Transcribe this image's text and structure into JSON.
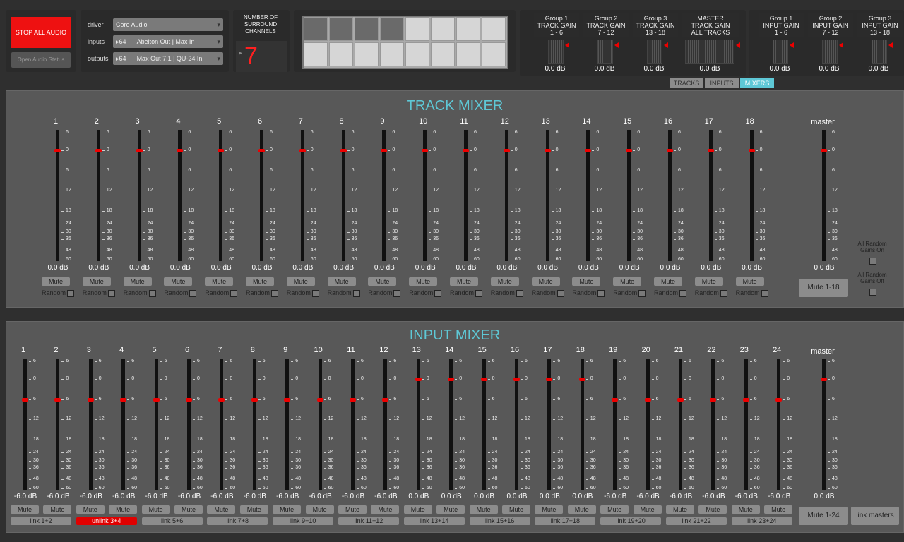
{
  "top": {
    "stop_label": "STOP ALL AUDIO",
    "status_label": "Open Audio Status",
    "driver_label": "driver",
    "driver_value": "Core Audio",
    "inputs_label": "inputs",
    "inputs_count": "64",
    "inputs_value": "Abelton Out | Max In",
    "outputs_label": "outputs",
    "outputs_count": "64",
    "outputs_value": "Max Out 7.1 | QU-24 In",
    "surround_header": "NUMBER OF SURROUND CHANNELS",
    "surround_value": "7",
    "grid_active": [
      true,
      true,
      true,
      true,
      false,
      false,
      false,
      false,
      false,
      false,
      false,
      false,
      false,
      false,
      false,
      false
    ]
  },
  "groups": [
    {
      "lines": [
        "Group 1",
        "TRACK GAIN",
        "1 - 6"
      ],
      "value": "0.0 dB"
    },
    {
      "lines": [
        "Group 2",
        "TRACK GAIN",
        "7 - 12"
      ],
      "value": "0.0 dB"
    },
    {
      "lines": [
        "Group 3",
        "TRACK GAIN",
        "13 - 18"
      ],
      "value": "0.0 dB"
    },
    {
      "lines": [
        "MASTER",
        "TRACK GAIN",
        "ALL TRACKS"
      ],
      "value": "0.0 dB"
    }
  ],
  "input_groups": [
    {
      "lines": [
        "Group 1",
        "INPUT GAIN",
        "1 - 6"
      ],
      "value": "0.0 dB"
    },
    {
      "lines": [
        "Group 2",
        "INPUT GAIN",
        "7 - 12"
      ],
      "value": "0.0 dB"
    },
    {
      "lines": [
        "Group 3",
        "INPUT GAIN",
        "13 - 18"
      ],
      "value": "0.0 dB"
    }
  ],
  "tabs": [
    "TRACKS",
    "INPUTS",
    "MIXERS"
  ],
  "active_tab": "MIXERS",
  "scale_labels": [
    "6",
    "0",
    "6",
    "12",
    "18",
    "24",
    "30",
    "36",
    "48",
    "60"
  ],
  "track_mixer": {
    "title": "TRACK MIXER",
    "channels": [
      "1",
      "2",
      "3",
      "4",
      "5",
      "6",
      "7",
      "8",
      "9",
      "10",
      "11",
      "12",
      "13",
      "14",
      "15",
      "16",
      "17",
      "18"
    ],
    "values_db": [
      "0.0 dB",
      "0.0 dB",
      "0.0 dB",
      "0.0 dB",
      "0.0 dB",
      "0.0 dB",
      "0.0 dB",
      "0.0 dB",
      "0.0 dB",
      "0.0 dB",
      "0.0 dB",
      "0.0 dB",
      "0.0 dB",
      "0.0 dB",
      "0.0 dB",
      "0.0 dB",
      "0.0 dB",
      "0.0 dB"
    ],
    "mute_label": "Mute",
    "random_label": "Random",
    "master_label": "master",
    "master_value": "0.0 dB",
    "mute_all": "Mute 1-18",
    "random_on": "All Random Gains On",
    "random_off": "All Random Gains Off"
  },
  "input_mixer": {
    "title": "INPUT MIXER",
    "channels": [
      "1",
      "2",
      "3",
      "4",
      "5",
      "6",
      "7",
      "8",
      "9",
      "10",
      "11",
      "12",
      "13",
      "14",
      "15",
      "16",
      "17",
      "18",
      "19",
      "20",
      "21",
      "22",
      "23",
      "24"
    ],
    "values_db": [
      "-6.0 dB",
      "-6.0 dB",
      "-6.0 dB",
      "-6.0 dB",
      "-6.0 dB",
      "-6.0 dB",
      "-6.0 dB",
      "-6.0 dB",
      "-6.0 dB",
      "-6.0 dB",
      "-6.0 dB",
      "-6.0 dB",
      "0.0 dB",
      "0.0 dB",
      "0.0 dB",
      "0.0 dB",
      "0.0 dB",
      "0.0 dB",
      "-6.0 dB",
      "-6.0 dB",
      "-6.0 dB",
      "-6.0 dB",
      "-6.0 dB",
      "-6.0 dB"
    ],
    "links": [
      "link 1+2",
      "unlink 3+4",
      "link 5+6",
      "link 7+8",
      "link 9+10",
      "link 11+12",
      "link 13+14",
      "link 15+16",
      "link 17+18",
      "link 19+20",
      "link 21+22",
      "link 23+24"
    ],
    "mute_label": "Mute",
    "master_label": "master",
    "master_value": "0.0 dB",
    "mute_all": "Mute 1-24",
    "link_masters": "link masters",
    "accent_color": "#5ec8d6",
    "active_link_color": "#e00000"
  }
}
